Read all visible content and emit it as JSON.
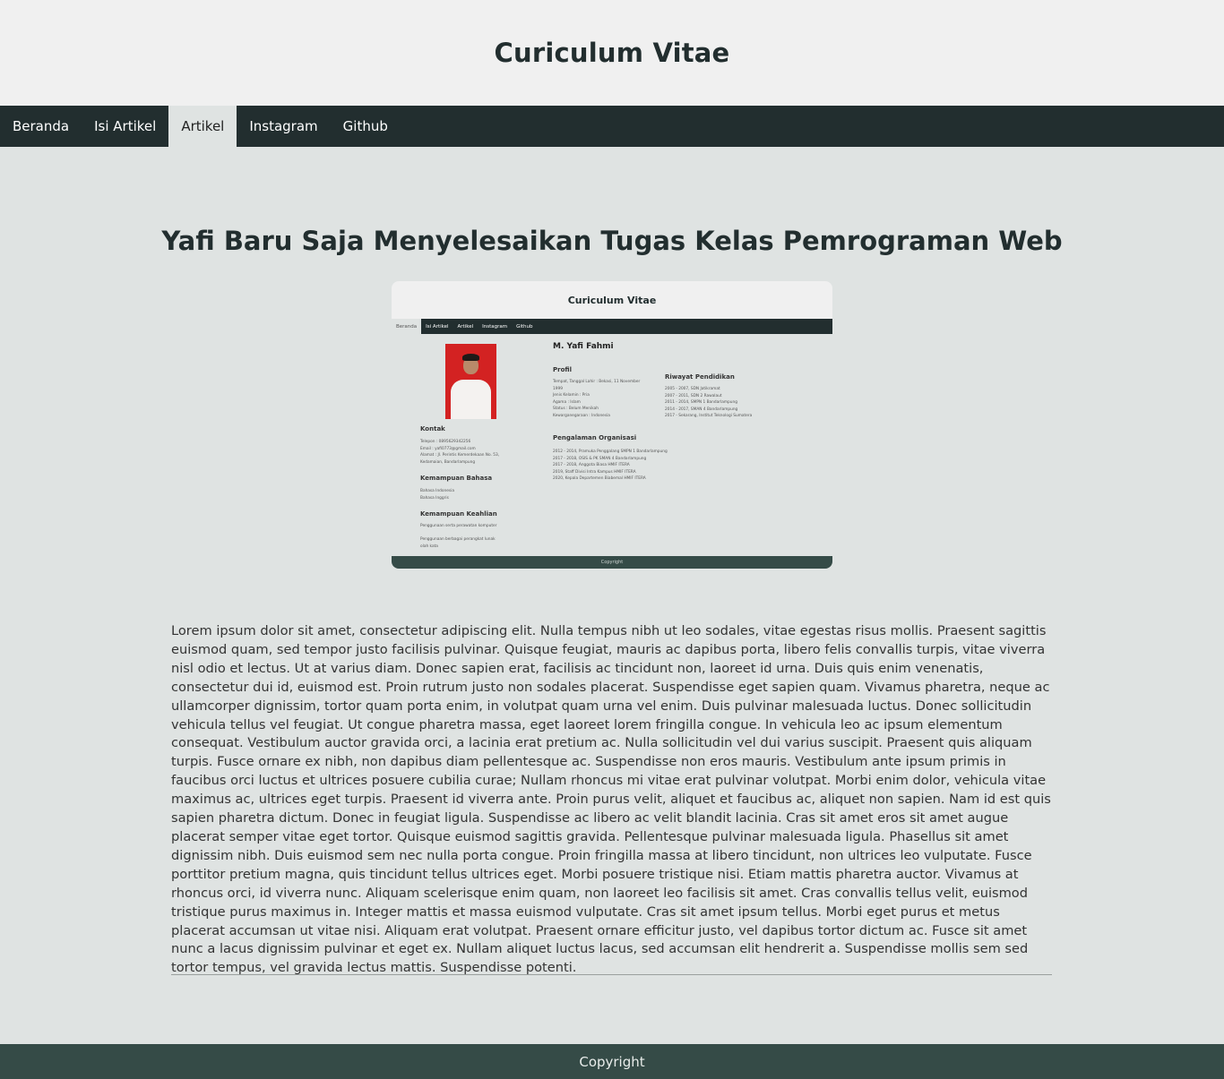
{
  "header": {
    "title": "Curiculum Vitae"
  },
  "nav": {
    "items": [
      {
        "label": "Beranda"
      },
      {
        "label": "Isi Artikel"
      },
      {
        "label": "Artikel"
      },
      {
        "label": "Instagram"
      },
      {
        "label": "Github"
      }
    ],
    "active": "Artikel"
  },
  "article": {
    "title": "Yafi Baru Saja Menyelesaikan Tugas Kelas Pemrograman Web",
    "body": "Lorem ipsum dolor sit amet, consectetur adipiscing elit. Nulla tempus nibh ut leo sodales, vitae egestas risus mollis. Praesent sagittis euismod quam, sed tempor justo facilisis pulvinar. Quisque feugiat, mauris ac dapibus porta, libero felis convallis turpis, vitae viverra nisl odio et lectus. Ut at varius diam. Donec sapien erat, facilisis ac tincidunt non, laoreet id urna. Duis quis enim venenatis, consectetur dui id, euismod est. Proin rutrum justo non sodales placerat. Suspendisse eget sapien quam. Vivamus pharetra, neque ac ullamcorper dignissim, tortor quam porta enim, in volutpat quam urna vel enim. Duis pulvinar malesuada luctus. Donec sollicitudin vehicula tellus vel feugiat. Ut congue pharetra massa, eget laoreet lorem fringilla congue. In vehicula leo ac ipsum elementum consequat. Vestibulum auctor gravida orci, a lacinia erat pretium ac. Nulla sollicitudin vel dui varius suscipit. Praesent quis aliquam turpis. Fusce ornare ex nibh, non dapibus diam pellentesque ac. Suspendisse non eros mauris. Vestibulum ante ipsum primis in faucibus orci luctus et ultrices posuere cubilia curae; Nullam rhoncus mi vitae erat pulvinar volutpat. Morbi enim dolor, vehicula vitae maximus ac, ultrices eget turpis. Praesent id viverra ante. Proin purus velit, aliquet et faucibus ac, aliquet non sapien. Nam id est quis sapien pharetra dictum. Donec in feugiat ligula. Suspendisse ac libero ac velit blandit lacinia. Cras sit amet eros sit amet augue placerat semper vitae eget tortor. Quisque euismod sagittis gravida. Pellentesque pulvinar malesuada ligula. Phasellus sit amet dignissim nibh. Duis euismod sem nec nulla porta congue. Proin fringilla massa at libero tincidunt, non ultrices leo vulputate. Fusce porttitor pretium magna, quis tincidunt tellus ultrices eget. Morbi posuere tristique nisi. Etiam mattis pharetra auctor. Vivamus at rhoncus orci, id viverra nunc. Aliquam scelerisque enim quam, non laoreet leo facilisis sit amet. Cras convallis tellus velit, euismod tristique purus maximus in. Integer mattis et massa euismod vulputate. Cras sit amet ipsum tellus. Morbi eget purus et metus placerat accumsan ut vitae nisi. Aliquam erat volutpat. Praesent ornare efficitur justo, vel dapibus tortor dictum ac. Fusce sit amet nunc a lacus dignissim pulvinar et eget ex. Nullam aliquet luctus lacus, sed accumsan elit hendrerit a. Suspendisse mollis sem sed tortor tempus, vel gravida lectus mattis. Suspendisse potenti."
  },
  "preview": {
    "header_title": "Curiculum Vitae",
    "nav": [
      "Beranda",
      "Isi Artikel",
      "Artikel",
      "Instagram",
      "Github"
    ],
    "name": "M. Yafi Fahmi",
    "profil_heading": "Profil",
    "profil_text": "Tempat, Tanggal Lahir : Bekasi, 11 November\n1999\nJenis Kelamin : Pria\nAgama : Islam\nStatus : Belum Menikah\nKewarganegaraan : Indonesia",
    "pendidikan_heading": "Riwayat Pendidikan",
    "pendidikan_text": "2005 - 2007, SDN Jatikramat\n2007 - 2011, SDN 2 Rawalaut\n2011 - 2014, SMPN 1 Bandarlampung\n2014 - 2017, SMAN 4 Bandarlampung\n2017 - Sekarang, Institut Teknologi Sumatera",
    "organisasi_heading": "Pengalaman Organisasi",
    "organisasi_text": "2012 - 2014, Pramuka Penggalang SMPN 1 Bandarlampung\n2017 - 2018, OSIS & PK SMAN 4 Bandarlampung\n2017 - 2018, Anggota Biasa HMIF ITERA\n2019, Staff Divisi Intra Kampus HMIF ITERA\n2020, Kepala Departemen Biabemal HMIF ITERA",
    "kontak_heading": "Kontak",
    "kontak_text": "Telepon : 0895629342256\nEmail : yafi0773@gmail.com\nAlamat : Jl. Perintis Kemerdekaan No. 53,\nKedamaian, Bandarlampung",
    "bahasa_heading": "Kemampuan Bahasa",
    "bahasa_text": "Bahasa Indonesia\nBahasa Inggris",
    "keahlian_heading": "Kemampuan Keahlian",
    "keahlian_text": "Penggunaan serta perawatan komputer\n\nPenggunaan berbagai perangkat lunak\nolah kata",
    "footer": "Copyright"
  },
  "footer": {
    "text": "Copyright"
  }
}
